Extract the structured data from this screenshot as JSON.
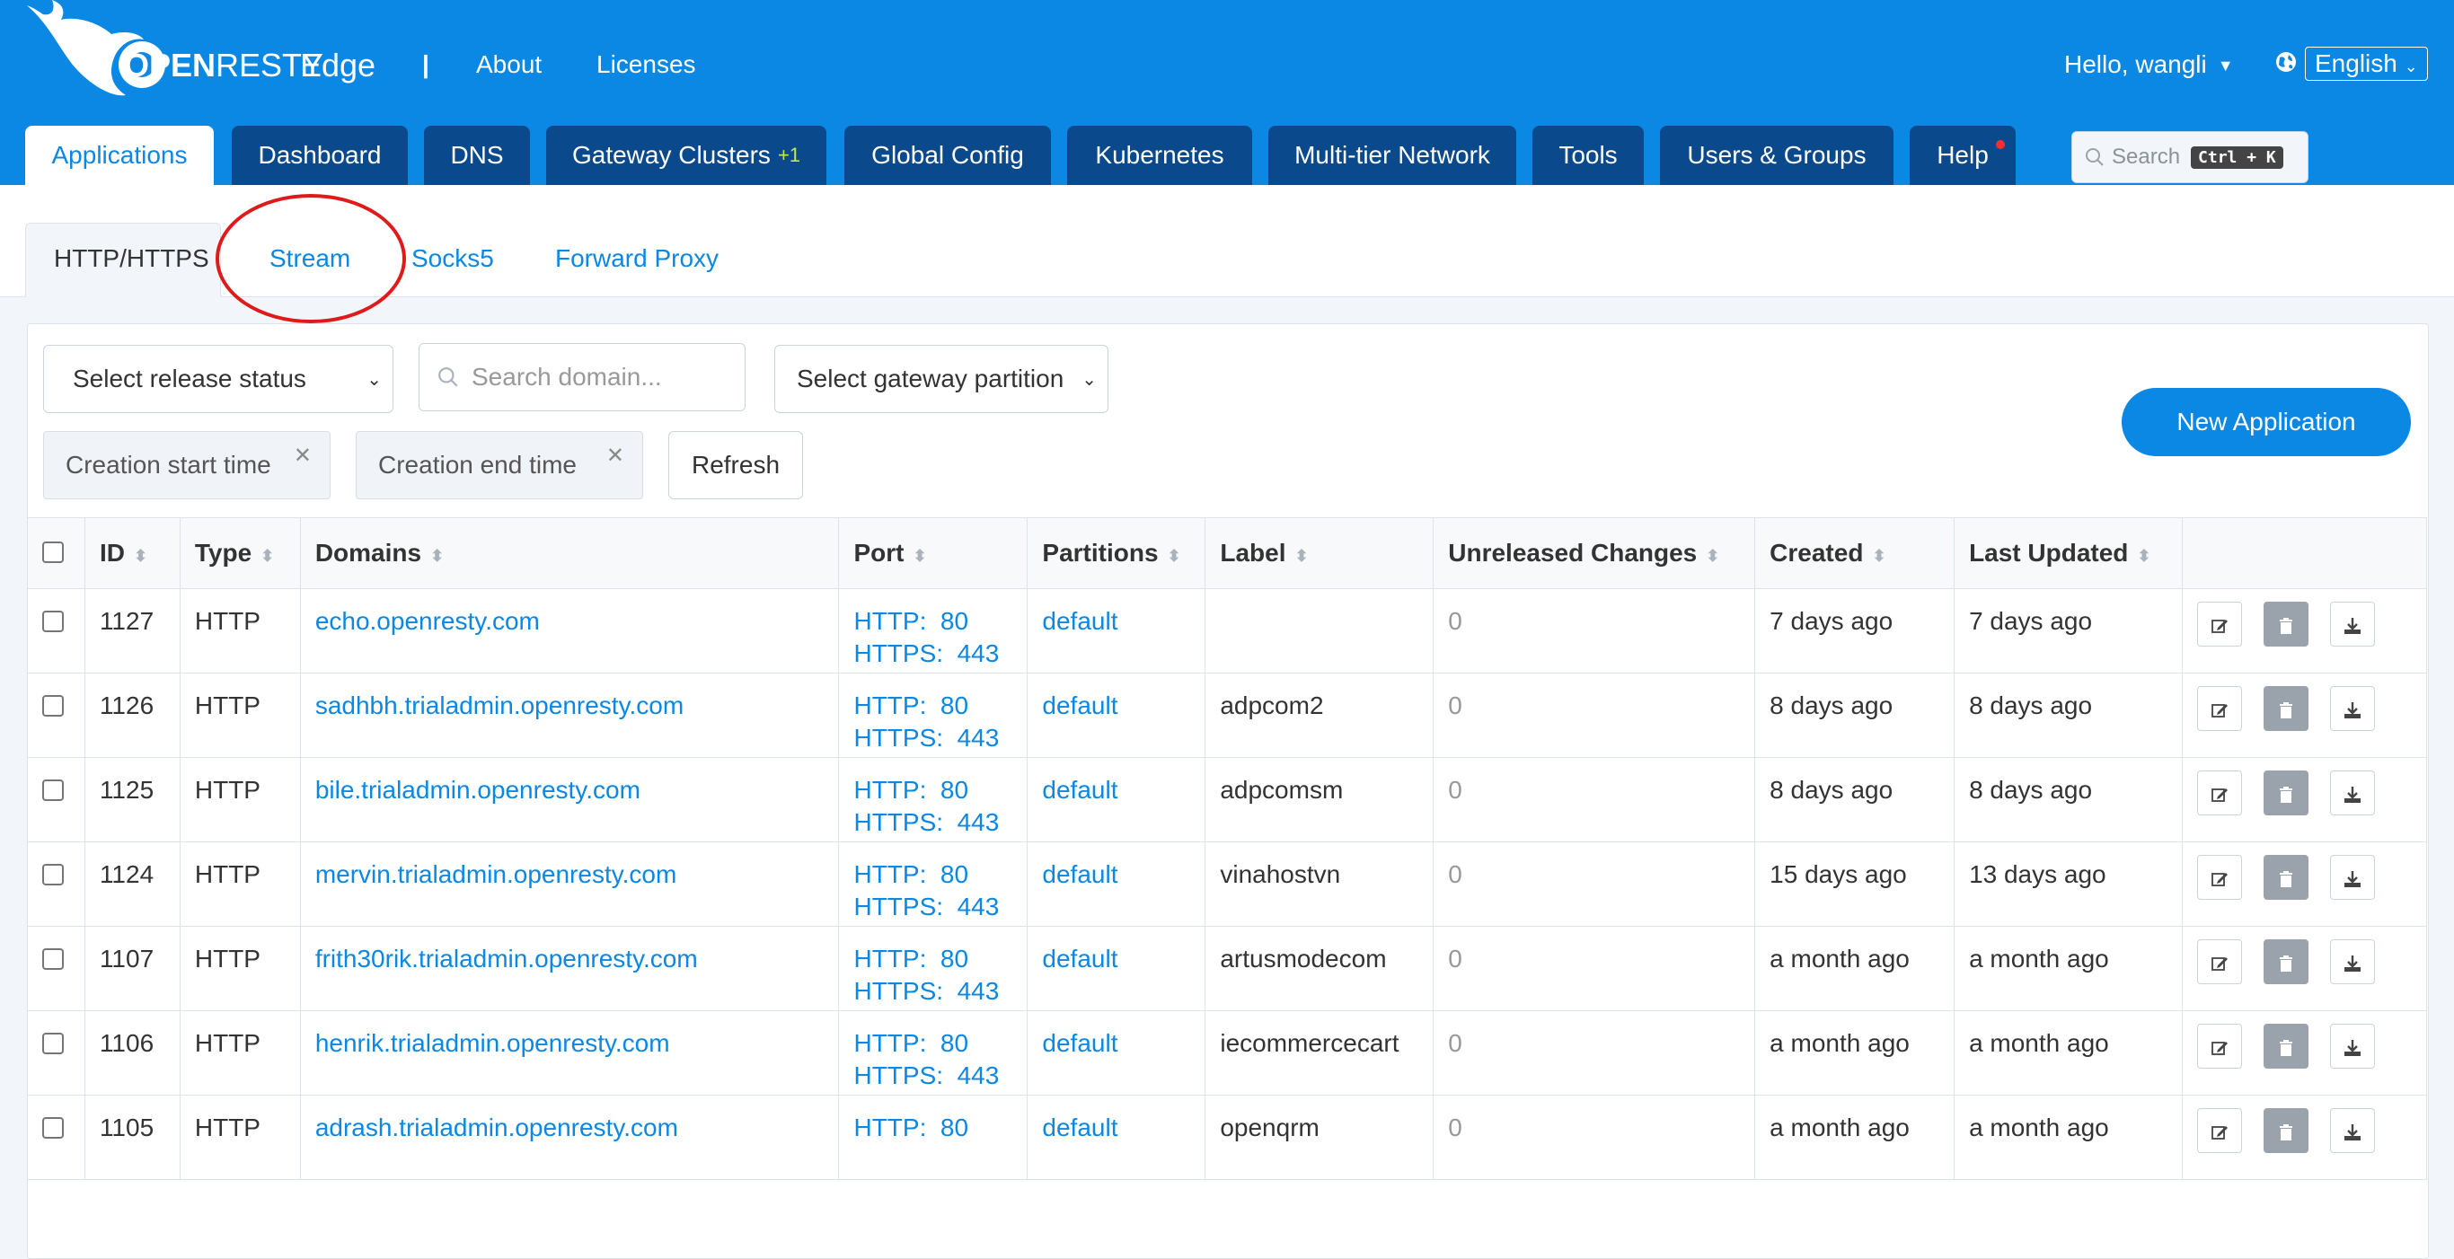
{
  "header": {
    "brand_openresty_1": "OPEN",
    "brand_openresty_2": "RESTY",
    "brand_product": "Edge",
    "separator": "|",
    "links": [
      "About",
      "Licenses"
    ],
    "greeting": "Hello, wangli",
    "language": "English"
  },
  "main_tabs": [
    {
      "label": "Applications",
      "active": true
    },
    {
      "label": "Dashboard"
    },
    {
      "label": "DNS"
    },
    {
      "label": "Gateway Clusters",
      "badge": "+1"
    },
    {
      "label": "Global Config"
    },
    {
      "label": "Kubernetes"
    },
    {
      "label": "Multi-tier Network"
    },
    {
      "label": "Tools"
    },
    {
      "label": "Users & Groups"
    },
    {
      "label": "Help",
      "notification_dot": true
    }
  ],
  "global_search": {
    "placeholder": "Search",
    "shortcut": "Ctrl + K"
  },
  "sub_tabs": [
    {
      "label": "HTTP/HTTPS",
      "active": true
    },
    {
      "label": "Stream",
      "highlighted": true
    },
    {
      "label": "Socks5"
    },
    {
      "label": "Forward Proxy"
    }
  ],
  "filters": {
    "release_status": "Select release status",
    "search_domain_placeholder": "Search domain...",
    "gateway_partition": "Select gateway partition",
    "creation_start": "Creation start time",
    "creation_end": "Creation end time",
    "refresh": "Refresh",
    "new_application": "New Application"
  },
  "table": {
    "columns": [
      "ID",
      "Type",
      "Domains",
      "Port",
      "Partitions",
      "Label",
      "Unreleased Changes",
      "Created",
      "Last Updated"
    ],
    "rows": [
      {
        "id": "1127",
        "type": "HTTP",
        "domain": "echo.openresty.com",
        "port_http": "HTTP:  80",
        "port_https": "HTTPS:  443",
        "partition": "default",
        "label": "",
        "unreleased": "0",
        "created": "7 days ago",
        "updated": "7 days ago"
      },
      {
        "id": "1126",
        "type": "HTTP",
        "domain": "sadhbh.trialadmin.openresty.com",
        "port_http": "HTTP:  80",
        "port_https": "HTTPS:  443",
        "partition": "default",
        "label": "adpcom2",
        "unreleased": "0",
        "created": "8 days ago",
        "updated": "8 days ago"
      },
      {
        "id": "1125",
        "type": "HTTP",
        "domain": "bile.trialadmin.openresty.com",
        "port_http": "HTTP:  80",
        "port_https": "HTTPS:  443",
        "partition": "default",
        "label": "adpcomsm",
        "unreleased": "0",
        "created": "8 days ago",
        "updated": "8 days ago"
      },
      {
        "id": "1124",
        "type": "HTTP",
        "domain": "mervin.trialadmin.openresty.com",
        "port_http": "HTTP:  80",
        "port_https": "HTTPS:  443",
        "partition": "default",
        "label": "vinahostvn",
        "unreleased": "0",
        "created": "15 days ago",
        "updated": "13 days ago"
      },
      {
        "id": "1107",
        "type": "HTTP",
        "domain": "frith30rik.trialadmin.openresty.com",
        "port_http": "HTTP:  80",
        "port_https": "HTTPS:  443",
        "partition": "default",
        "label": "artusmodecom",
        "unreleased": "0",
        "created": "a month ago",
        "updated": "a month ago"
      },
      {
        "id": "1106",
        "type": "HTTP",
        "domain": "henrik.trialadmin.openresty.com",
        "port_http": "HTTP:  80",
        "port_https": "HTTPS:  443",
        "partition": "default",
        "label": "iecommercecart",
        "unreleased": "0",
        "created": "a month ago",
        "updated": "a month ago"
      },
      {
        "id": "1105",
        "type": "HTTP",
        "domain": "adrash.trialadmin.openresty.com",
        "port_http": "HTTP:  80",
        "port_https": "",
        "partition": "default",
        "label": "openqrm",
        "unreleased": "0",
        "created": "a month ago",
        "updated": "a month ago"
      }
    ]
  },
  "colors": {
    "primary": "#0b87e4",
    "nav_dark": "#0a4a8c",
    "highlight_circle": "#e01a1a"
  }
}
